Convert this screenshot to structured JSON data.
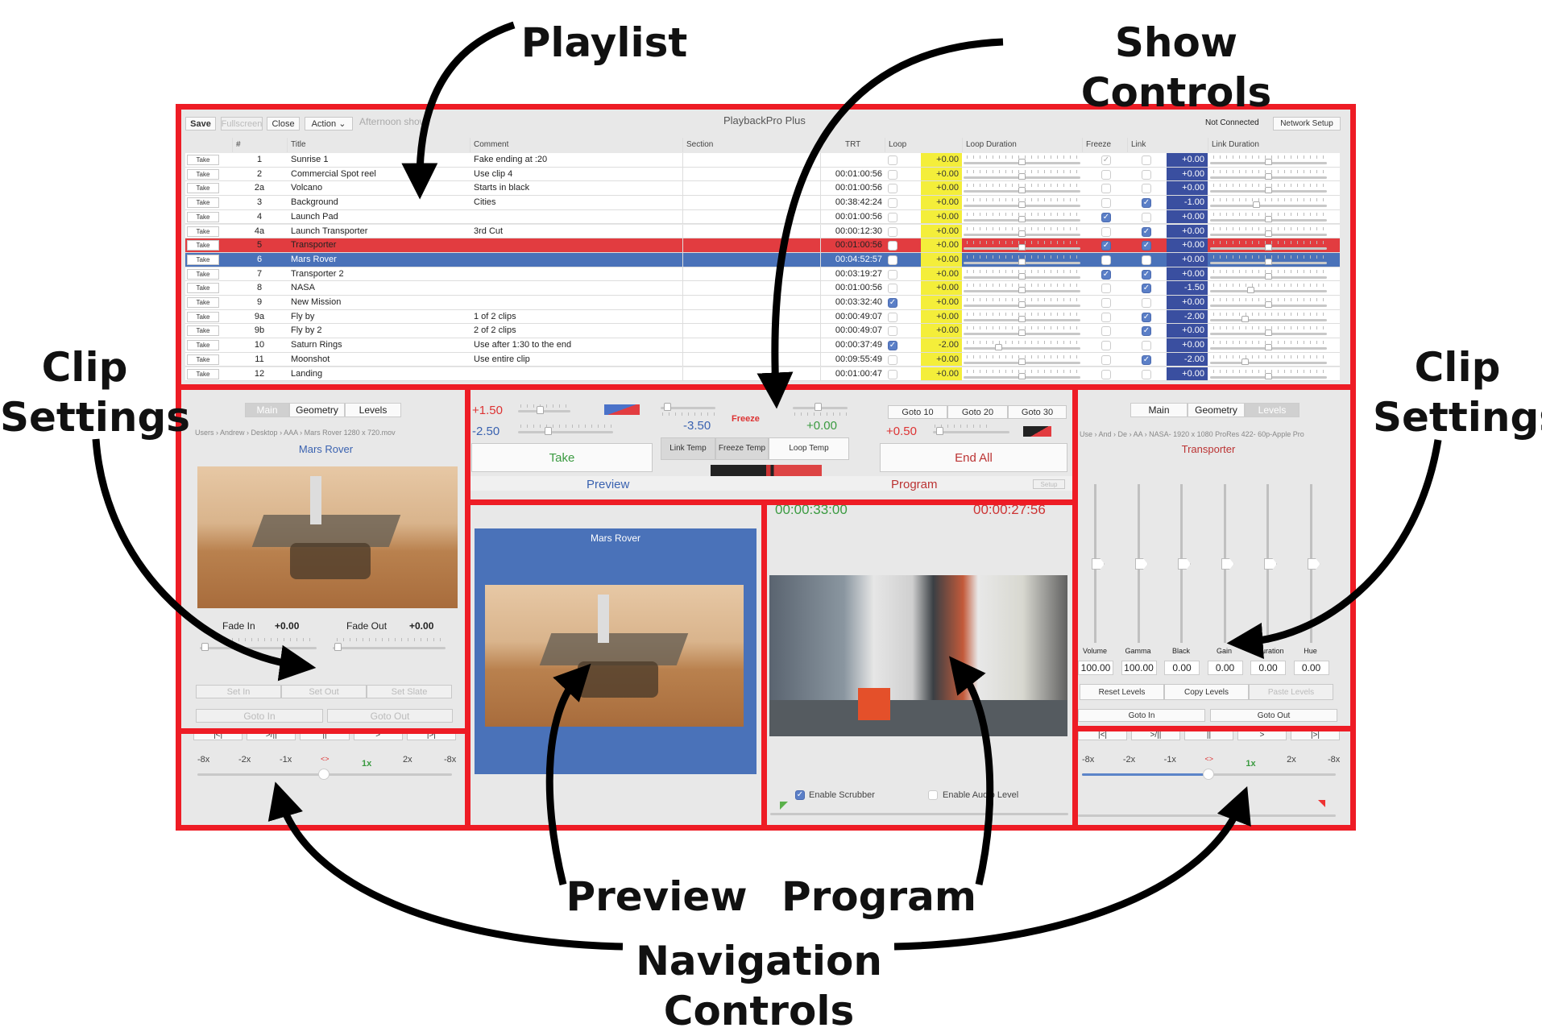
{
  "annotations": {
    "playlist": "Playlist",
    "show_controls": "Show Controls",
    "clip_settings_left": [
      "Clip",
      "Settings"
    ],
    "clip_settings_right": [
      "Clip",
      "Settings"
    ],
    "preview": "Preview",
    "program": "Program",
    "navigation": [
      "Navigation",
      "Controls"
    ]
  },
  "colors": {
    "annotation_frame": "#ee1c25",
    "preview_blue": "#4a72b9",
    "program_red": "#e23c40",
    "loop_yellow": "#f4ee3a",
    "link_blue": "#3a4fa0"
  },
  "toolbar": {
    "save": "Save",
    "fullscreen": "Fullscreen",
    "close": "Close",
    "action": "Action",
    "show_name": "Afternoon show",
    "app_title": "PlaybackPro Plus",
    "status": "Not Connected",
    "network_setup": "Network Setup"
  },
  "playlist": {
    "headers": {
      "num": "#",
      "title": "Title",
      "comment": "Comment",
      "section": "Section",
      "trt": "TRT",
      "loop": "Loop",
      "loop_duration": "Loop Duration",
      "freeze": "Freeze",
      "link": "Link",
      "link_duration": "Link Duration"
    },
    "take_label": "Take",
    "rows": [
      {
        "num": "1",
        "title": "Sunrise 1",
        "comment": "Fake ending at :20",
        "trt": "",
        "loop": false,
        "loop_val": "+0.00",
        "freeze": "dim",
        "link": false,
        "link_val": "+0.00"
      },
      {
        "num": "2",
        "title": "Commercial Spot reel",
        "comment": "Use clip 4",
        "trt": "00:01:00:56",
        "loop": false,
        "loop_val": "+0.00",
        "freeze": false,
        "link": false,
        "link_val": "+0.00"
      },
      {
        "num": "2a",
        "title": "Volcano",
        "comment": "Starts in black",
        "trt": "00:01:00:56",
        "loop": false,
        "loop_val": "+0.00",
        "freeze": false,
        "link": false,
        "link_val": "+0.00"
      },
      {
        "num": "3",
        "title": "Background",
        "comment": "Cities",
        "trt": "00:38:42:24",
        "loop": false,
        "loop_val": "+0.00",
        "freeze": false,
        "link": true,
        "link_val": "-1.00"
      },
      {
        "num": "4",
        "title": "Launch Pad",
        "comment": "",
        "trt": "00:01:00:56",
        "loop": false,
        "loop_val": "+0.00",
        "freeze": true,
        "link": false,
        "link_val": "+0.00"
      },
      {
        "num": "4a",
        "title": "Launch Transporter",
        "comment": "3rd Cut",
        "trt": "00:00:12:30",
        "loop": false,
        "loop_val": "+0.00",
        "freeze": false,
        "link": true,
        "link_val": "+0.00"
      },
      {
        "num": "5",
        "title": "Transporter",
        "comment": "",
        "trt": "00:01:00:56",
        "loop": false,
        "loop_val": "+0.00",
        "freeze": true,
        "link": true,
        "link_val": "+0.00",
        "state": "program"
      },
      {
        "num": "6",
        "title": "Mars Rover",
        "comment": "",
        "trt": "00:04:52:57",
        "loop": false,
        "loop_val": "+0.00",
        "freeze": false,
        "link": false,
        "link_val": "+0.00",
        "state": "preview"
      },
      {
        "num": "7",
        "title": "Transporter 2",
        "comment": "",
        "trt": "00:03:19:27",
        "loop": false,
        "loop_val": "+0.00",
        "freeze": true,
        "link": true,
        "link_val": "+0.00"
      },
      {
        "num": "8",
        "title": "NASA",
        "comment": "",
        "trt": "00:01:00:56",
        "loop": false,
        "loop_val": "+0.00",
        "freeze": false,
        "link": true,
        "link_val": "-1.50"
      },
      {
        "num": "9",
        "title": "New Mission",
        "comment": "",
        "trt": "00:03:32:40",
        "loop": true,
        "loop_val": "+0.00",
        "freeze": false,
        "link": false,
        "link_val": "+0.00"
      },
      {
        "num": "9a",
        "title": "Fly by",
        "comment": "1 of 2 clips",
        "trt": "00:00:49:07",
        "loop": false,
        "loop_val": "+0.00",
        "freeze": false,
        "link": true,
        "link_val": "-2.00"
      },
      {
        "num": "9b",
        "title": "Fly by 2",
        "comment": "2 of 2 clips",
        "trt": "00:00:49:07",
        "loop": false,
        "loop_val": "+0.00",
        "freeze": false,
        "link": true,
        "link_val": "+0.00"
      },
      {
        "num": "10",
        "title": "Saturn Rings",
        "comment": "Use after 1:30 to the end",
        "trt": "00:00:37:49",
        "loop": true,
        "loop_val": "-2.00",
        "freeze": false,
        "link": false,
        "link_val": "+0.00"
      },
      {
        "num": "11",
        "title": "Moonshot",
        "comment": "Use entire clip",
        "trt": "00:09:55:49",
        "loop": false,
        "loop_val": "+0.00",
        "freeze": false,
        "link": true,
        "link_val": "-2.00"
      },
      {
        "num": "12",
        "title": "Landing",
        "comment": "",
        "trt": "00:01:00:47",
        "loop": false,
        "loop_val": "+0.00",
        "freeze": false,
        "link": false,
        "link_val": "+0.00"
      }
    ]
  },
  "left_clip": {
    "tabs": [
      "Main",
      "Geometry",
      "Levels"
    ],
    "selected_tab": "Main",
    "path": [
      "Users",
      "Andrew",
      "Desktop",
      "AAA",
      "Mars Rover 1280 x 720.mov"
    ],
    "clip_title": "Mars Rover",
    "fade_in_label": "Fade In",
    "fade_in": "+0.00",
    "fade_out_label": "Fade Out",
    "fade_out": "+0.00",
    "set_in": "Set In",
    "set_out": "Set Out",
    "set_slate": "Set Slate",
    "goto_in": "Goto In",
    "goto_out": "Goto Out"
  },
  "show_controls": {
    "preview_top": "+1.50",
    "preview_bottom": "-2.50",
    "take": "Take",
    "link_val": "-3.50",
    "freeze": "Freeze",
    "loop_val": "+0.00",
    "link_temp": "Link Temp",
    "freeze_temp": "Freeze Temp",
    "loop_temp": "Loop Temp",
    "goto10": "Goto 10",
    "goto20": "Goto 20",
    "goto30": "Goto 30",
    "program_val": "+0.50",
    "end_all": "End All",
    "preview_label": "Preview",
    "program_label": "Program",
    "setup": "Setup"
  },
  "preview": {
    "clip_title": "Mars Rover"
  },
  "program": {
    "elapsed": "00:00:33:00",
    "remaining": "00:00:27:56",
    "enable_scrubber": "Enable Scrubber",
    "enable_scrubber_checked": true,
    "enable_audio": "Enable Audio Level",
    "enable_audio_checked": false
  },
  "right_clip": {
    "tabs": [
      "Main",
      "Geometry",
      "Levels"
    ],
    "selected_tab": "Levels",
    "path": [
      "Use",
      "And",
      "De",
      "AA",
      "NASA- 1920 x 1080 ProRes 422- 60p-Apple Pro"
    ],
    "clip_title": "Transporter",
    "levels": [
      {
        "label": "Volume",
        "value": "100.00"
      },
      {
        "label": "Gamma",
        "value": "100.00"
      },
      {
        "label": "Black",
        "value": "0.00"
      },
      {
        "label": "Gain",
        "value": "0.00"
      },
      {
        "label": "Saturation",
        "value": "0.00"
      },
      {
        "label": "Hue",
        "value": "0.00"
      }
    ],
    "reset": "Reset Levels",
    "copy": "Copy Levels",
    "paste": "Paste Levels",
    "goto_in": "Goto In",
    "goto_out": "Goto Out"
  },
  "navigation": {
    "transport": [
      "|<|",
      ">/||",
      "||",
      ">",
      "|>|"
    ],
    "speeds": [
      "-8x",
      "-2x",
      "-1x",
      "<>",
      "1x",
      "2x",
      "-8x"
    ]
  }
}
